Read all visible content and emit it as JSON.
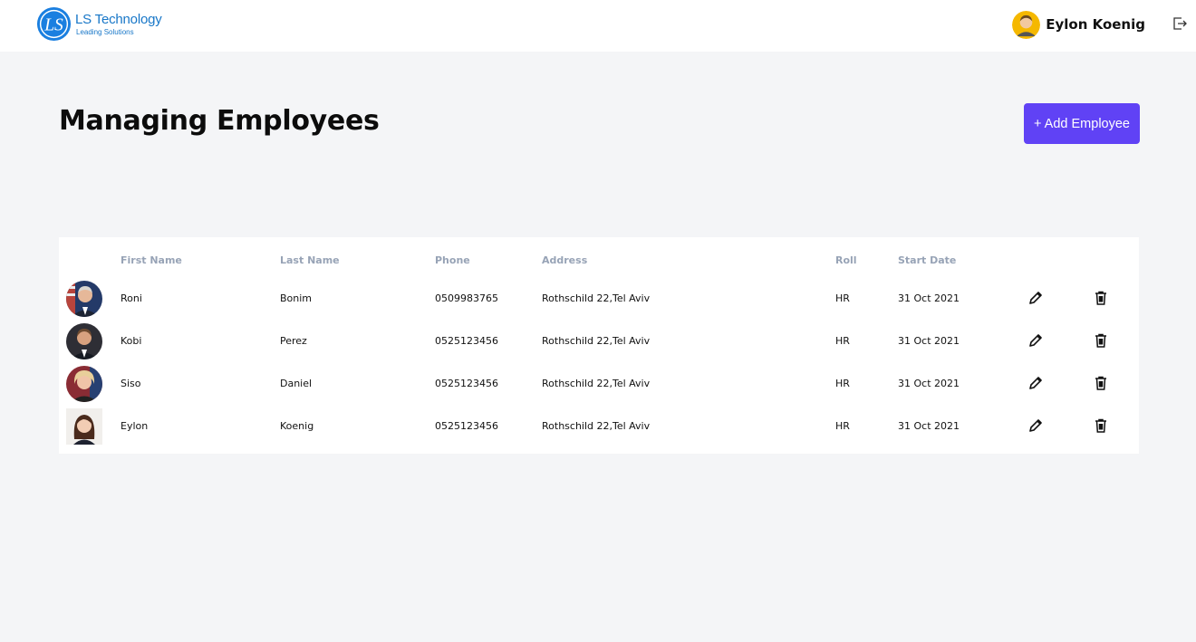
{
  "brand": {
    "name": "LS Technology",
    "tagline": "Leading Solutions",
    "color": "#1877c8",
    "icon": "ls-logo-icon"
  },
  "user": {
    "name": "Eylon Koenig",
    "avatar_icon": "user-avatar-icon",
    "logout_icon": "logout-icon"
  },
  "page": {
    "title": "Managing Employees",
    "add_button_label": "+ Add Employee",
    "accent": "#6042f5"
  },
  "table": {
    "headers": {
      "first_name": "First Name",
      "last_name": "Last Name",
      "phone": "Phone",
      "address": "Address",
      "roll": "Roll",
      "start_date": "Start Date"
    },
    "rows": [
      {
        "first_name": "Roni",
        "last_name": "Bonim",
        "phone": "0509983765",
        "address": "Rothschild 22,Tel Aviv",
        "roll": "HR",
        "start_date": "31 Oct 2021"
      },
      {
        "first_name": "Kobi",
        "last_name": "Perez",
        "phone": "0525123456",
        "address": "Rothschild 22,Tel Aviv",
        "roll": "HR",
        "start_date": "31 Oct 2021"
      },
      {
        "first_name": "Siso",
        "last_name": "Daniel",
        "phone": "0525123456",
        "address": "Rothschild 22,Tel Aviv",
        "roll": "HR",
        "start_date": "31 Oct 2021"
      },
      {
        "first_name": "Eylon",
        "last_name": "Koenig",
        "phone": "0525123456",
        "address": "Rothschild 22,Tel Aviv",
        "roll": "HR",
        "start_date": "31 Oct 2021"
      }
    ],
    "edit_icon": "pencil-icon",
    "delete_icon": "trash-icon"
  }
}
